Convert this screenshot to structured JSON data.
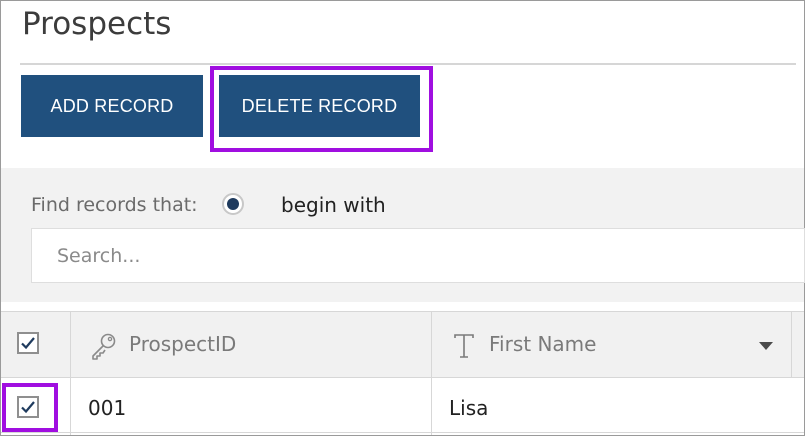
{
  "page": {
    "title": "Prospects"
  },
  "toolbar": {
    "add_label": "ADD RECORD",
    "delete_label": "DELETE RECORD"
  },
  "filter": {
    "find_label": "Find records that:",
    "option_label": "begin with",
    "option_selected": true,
    "search_placeholder": "Search...",
    "search_value": ""
  },
  "table": {
    "select_all_checked": true,
    "columns": [
      {
        "label": "ProspectID",
        "icon": "key-icon"
      },
      {
        "label": "First Name",
        "icon": "text-type-icon",
        "menu_icon": "caret-down-icon"
      }
    ],
    "rows": [
      {
        "checked": true,
        "cells": [
          "001",
          "Lisa"
        ]
      }
    ]
  },
  "colors": {
    "primary_button": "#20507e",
    "highlight": "#a00ee0",
    "radio_fill": "#1f3b5e"
  }
}
